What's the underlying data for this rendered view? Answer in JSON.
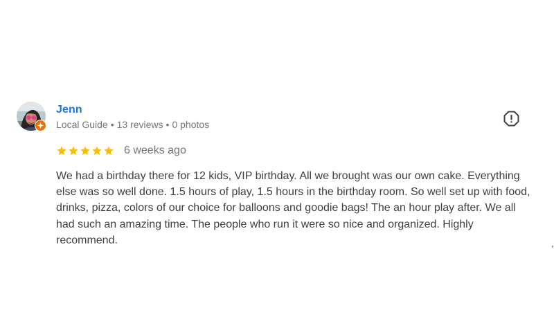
{
  "reviewer": {
    "name": "Jenn",
    "badge": "Local Guide",
    "reviews": "13 reviews",
    "photos": "0 photos",
    "separator": "•",
    "avatar_icon": "profile-photo",
    "badge_icon": "local-guide-star-icon"
  },
  "review": {
    "rating": 5,
    "max_rating": 5,
    "date": "6 weeks ago",
    "text": "We had a birthday there for 12 kids, VIP birthday. All we brought was our own cake. Everything else was so well done. 1.5 hours of play, 1.5 hours in the birthday room. So well set up with food, drinks, pizza, colors of our choice for balloons and goodie bags! The an hour play after. We all had such an amazing time. The people who run it were so nice and organized. Highly recommend."
  },
  "actions": {
    "report_icon": "report-icon"
  },
  "colors": {
    "name": "#1a73e8",
    "meta": "#70757a",
    "text": "#3c4043",
    "star": "#fbbc04",
    "badge": "#e8710a"
  }
}
